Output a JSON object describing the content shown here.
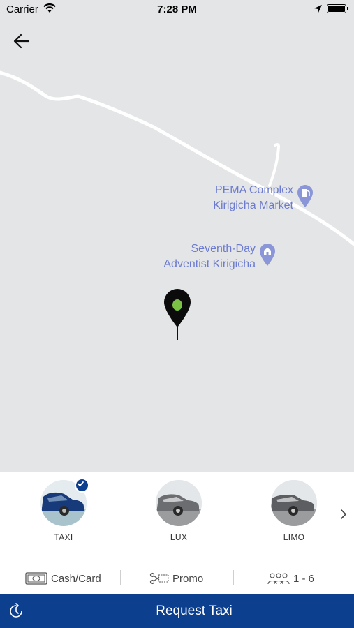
{
  "status_bar": {
    "carrier": "Carrier",
    "time": "7:28 PM"
  },
  "map": {
    "places": [
      {
        "line1": "PEMA Complex",
        "line2": "Kirigicha Market",
        "icon": "fuel-station-icon"
      },
      {
        "line1": "Seventh-Day",
        "line2": "Adventist Kirigicha",
        "icon": "church-icon"
      }
    ],
    "pickup_pin_icon": "map-pin-icon"
  },
  "vehicles": [
    {
      "label": "TAXI",
      "selected": true
    },
    {
      "label": "LUX",
      "selected": false
    },
    {
      "label": "LIMO",
      "selected": false
    }
  ],
  "options": {
    "payment": "Cash/Card",
    "promo": "Promo",
    "passengers": "1 - 6"
  },
  "request": {
    "label": "Request Taxi"
  },
  "colors": {
    "brand": "#0d3f8f",
    "map_bg": "#e3e5e6",
    "poi_text": "#6c7bd0",
    "pin_dot": "#7bc143"
  }
}
